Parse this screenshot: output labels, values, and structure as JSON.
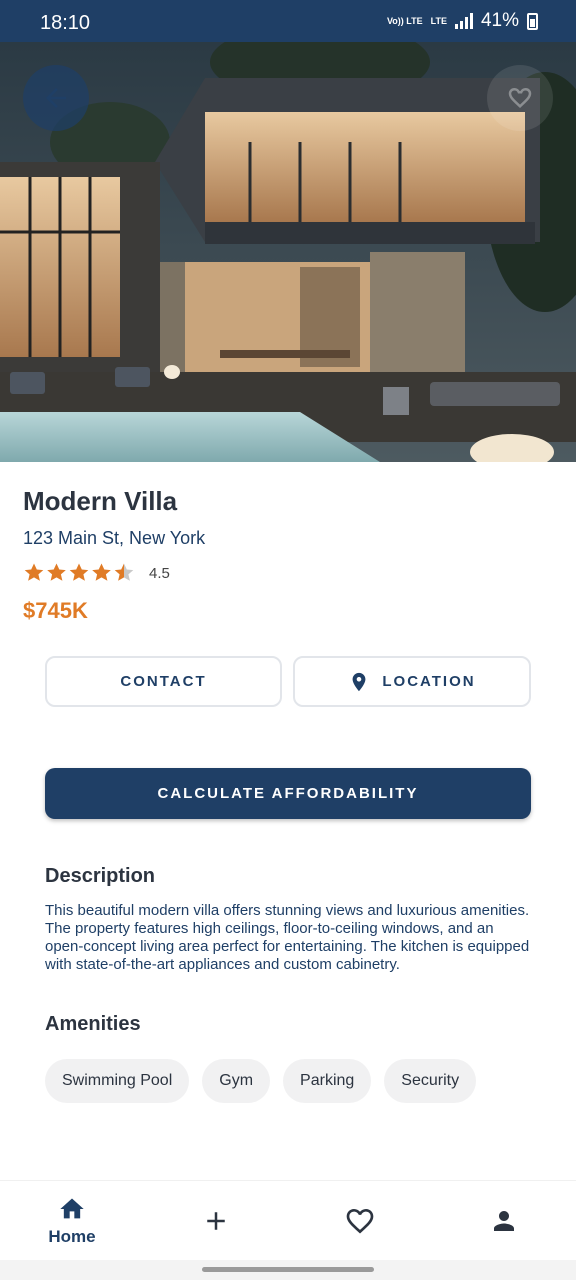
{
  "status_bar": {
    "time": "18:10",
    "network_top": "Vo)) LTE",
    "network_bottom": "LTE",
    "battery": "41%"
  },
  "hero": {
    "image_alt": "Modern villa exterior at dusk with pool",
    "back_icon": "arrow-back-icon",
    "favorite_icon": "heart-outline-icon"
  },
  "property": {
    "title": "Modern Villa",
    "address": "123 Main St, New York",
    "rating": 4.5,
    "rating_text": "4.5",
    "price": "$745K"
  },
  "actions": {
    "contact_label": "CONTACT",
    "location_label": "LOCATION",
    "affordability_label": "CALCULATE AFFORDABILITY"
  },
  "description": {
    "title": "Description",
    "text": "This beautiful modern villa offers stunning views and luxurious amenities. The property features high ceilings, floor-to-ceiling windows, and an open-concept living area perfect for entertaining. The kitchen is equipped with state-of-the-art appliances and custom cabinetry."
  },
  "amenities": {
    "title": "Amenities",
    "items": [
      "Swimming Pool",
      "Gym",
      "Parking",
      "Security"
    ]
  },
  "bottom_nav": {
    "items": [
      {
        "label": "Home",
        "icon": "home-icon",
        "active": true
      },
      {
        "label": "",
        "icon": "plus-icon",
        "active": false
      },
      {
        "label": "",
        "icon": "heart-outline-icon",
        "active": false
      },
      {
        "label": "",
        "icon": "person-icon",
        "active": false
      }
    ]
  },
  "colors": {
    "primary": "#1f3f66",
    "accent": "#e07b26",
    "star": "#e07b26"
  }
}
